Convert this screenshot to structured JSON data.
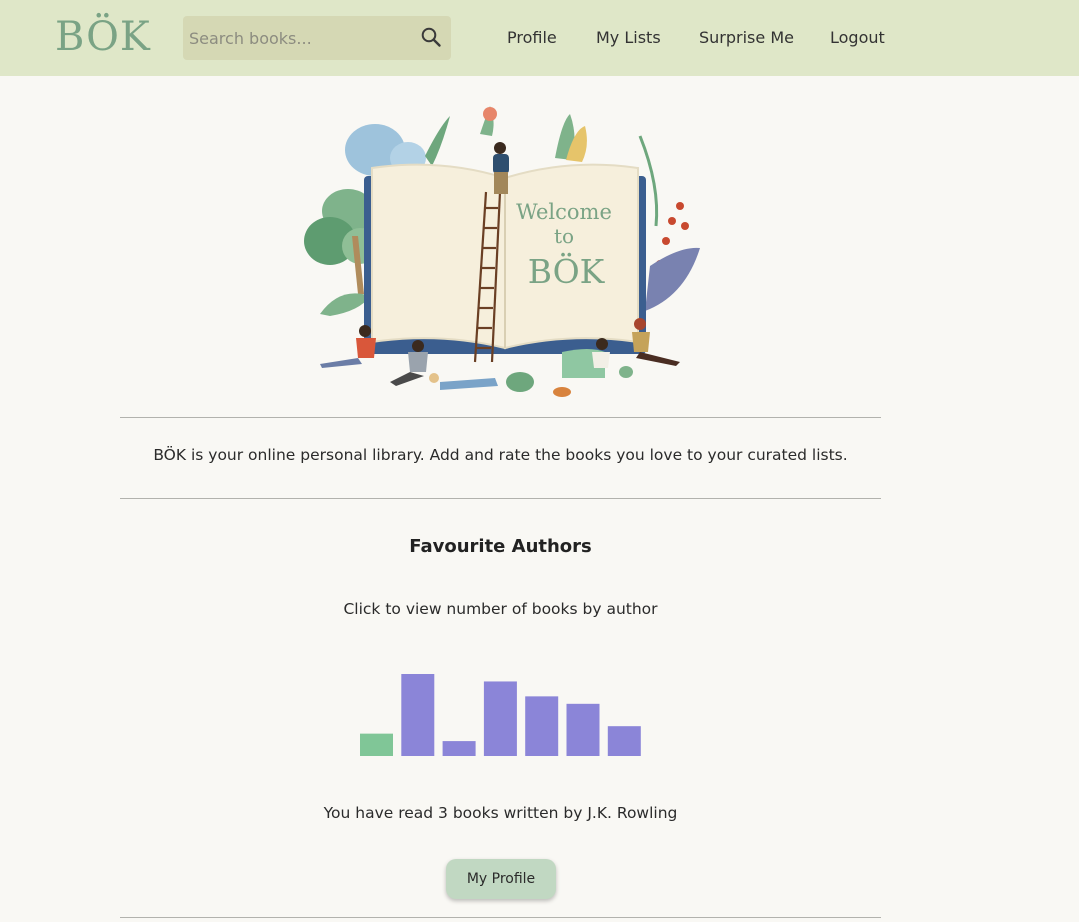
{
  "header": {
    "logo": "BÖK",
    "search": {
      "placeholder": "Search books...",
      "value": ""
    },
    "nav": {
      "profile": "Profile",
      "my_lists": "My Lists",
      "surprise_me": "Surprise Me",
      "logout": "Logout"
    }
  },
  "hero": {
    "line1": "Welcome",
    "line2": "to",
    "line3": "BÖK"
  },
  "intro": "BÖK is your online personal library. Add and rate the books you love to your curated lists.",
  "authors": {
    "title": "Favourite Authors",
    "subtitle": "Click to view number of books by author",
    "read_text": "You have read 3 books written by J.K. Rowling",
    "button": "My Profile"
  },
  "chart_data": {
    "type": "bar",
    "categories": [
      "",
      "",
      "",
      "",
      "",
      "",
      ""
    ],
    "values": [
      3,
      11,
      2,
      10,
      8,
      7,
      4
    ],
    "ylim": [
      0,
      11
    ],
    "highlight_index": 0,
    "grid": false,
    "colors": {
      "default": "#8b85d8",
      "highlight": "#80c697"
    }
  },
  "colors": {
    "navbar": "#dfe7c8",
    "search": "#d5d8b4",
    "accent": "#7aa385",
    "background": "#f9f8f4",
    "button": "#c1d8c2"
  }
}
